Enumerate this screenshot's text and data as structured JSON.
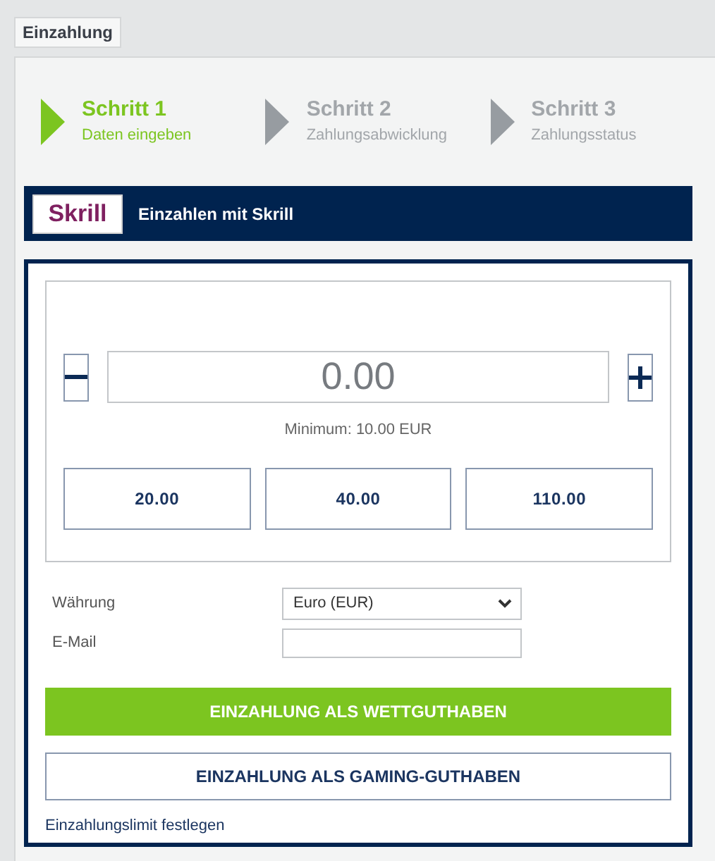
{
  "tab": {
    "label": "Einzahlung"
  },
  "steps": [
    {
      "title": "Schritt 1",
      "subtitle": "Daten eingeben",
      "active": true
    },
    {
      "title": "Schritt 2",
      "subtitle": "Zahlungsabwicklung",
      "active": false
    },
    {
      "title": "Schritt 3",
      "subtitle": "Zahlungsstatus",
      "active": false
    }
  ],
  "method": {
    "logo": "Skrill",
    "label": "Einzahlen mit Skrill"
  },
  "amount": {
    "value": "0.00",
    "minimum": "Minimum: 10.00 EUR"
  },
  "quick_amounts": [
    "20.00",
    "40.00",
    "110.00"
  ],
  "currency": {
    "label": "Währung",
    "value": "Euro (EUR)"
  },
  "email": {
    "label": "E-Mail"
  },
  "buttons": [
    {
      "label": "EINZAHLUNG ALS WETTGUTHABEN",
      "kind": "primary"
    },
    {
      "label": "EINZAHLUNG ALS GAMING-GUTHABEN",
      "kind": "secondary"
    }
  ],
  "limit_link": "Einzahlungslimit festlegen"
}
